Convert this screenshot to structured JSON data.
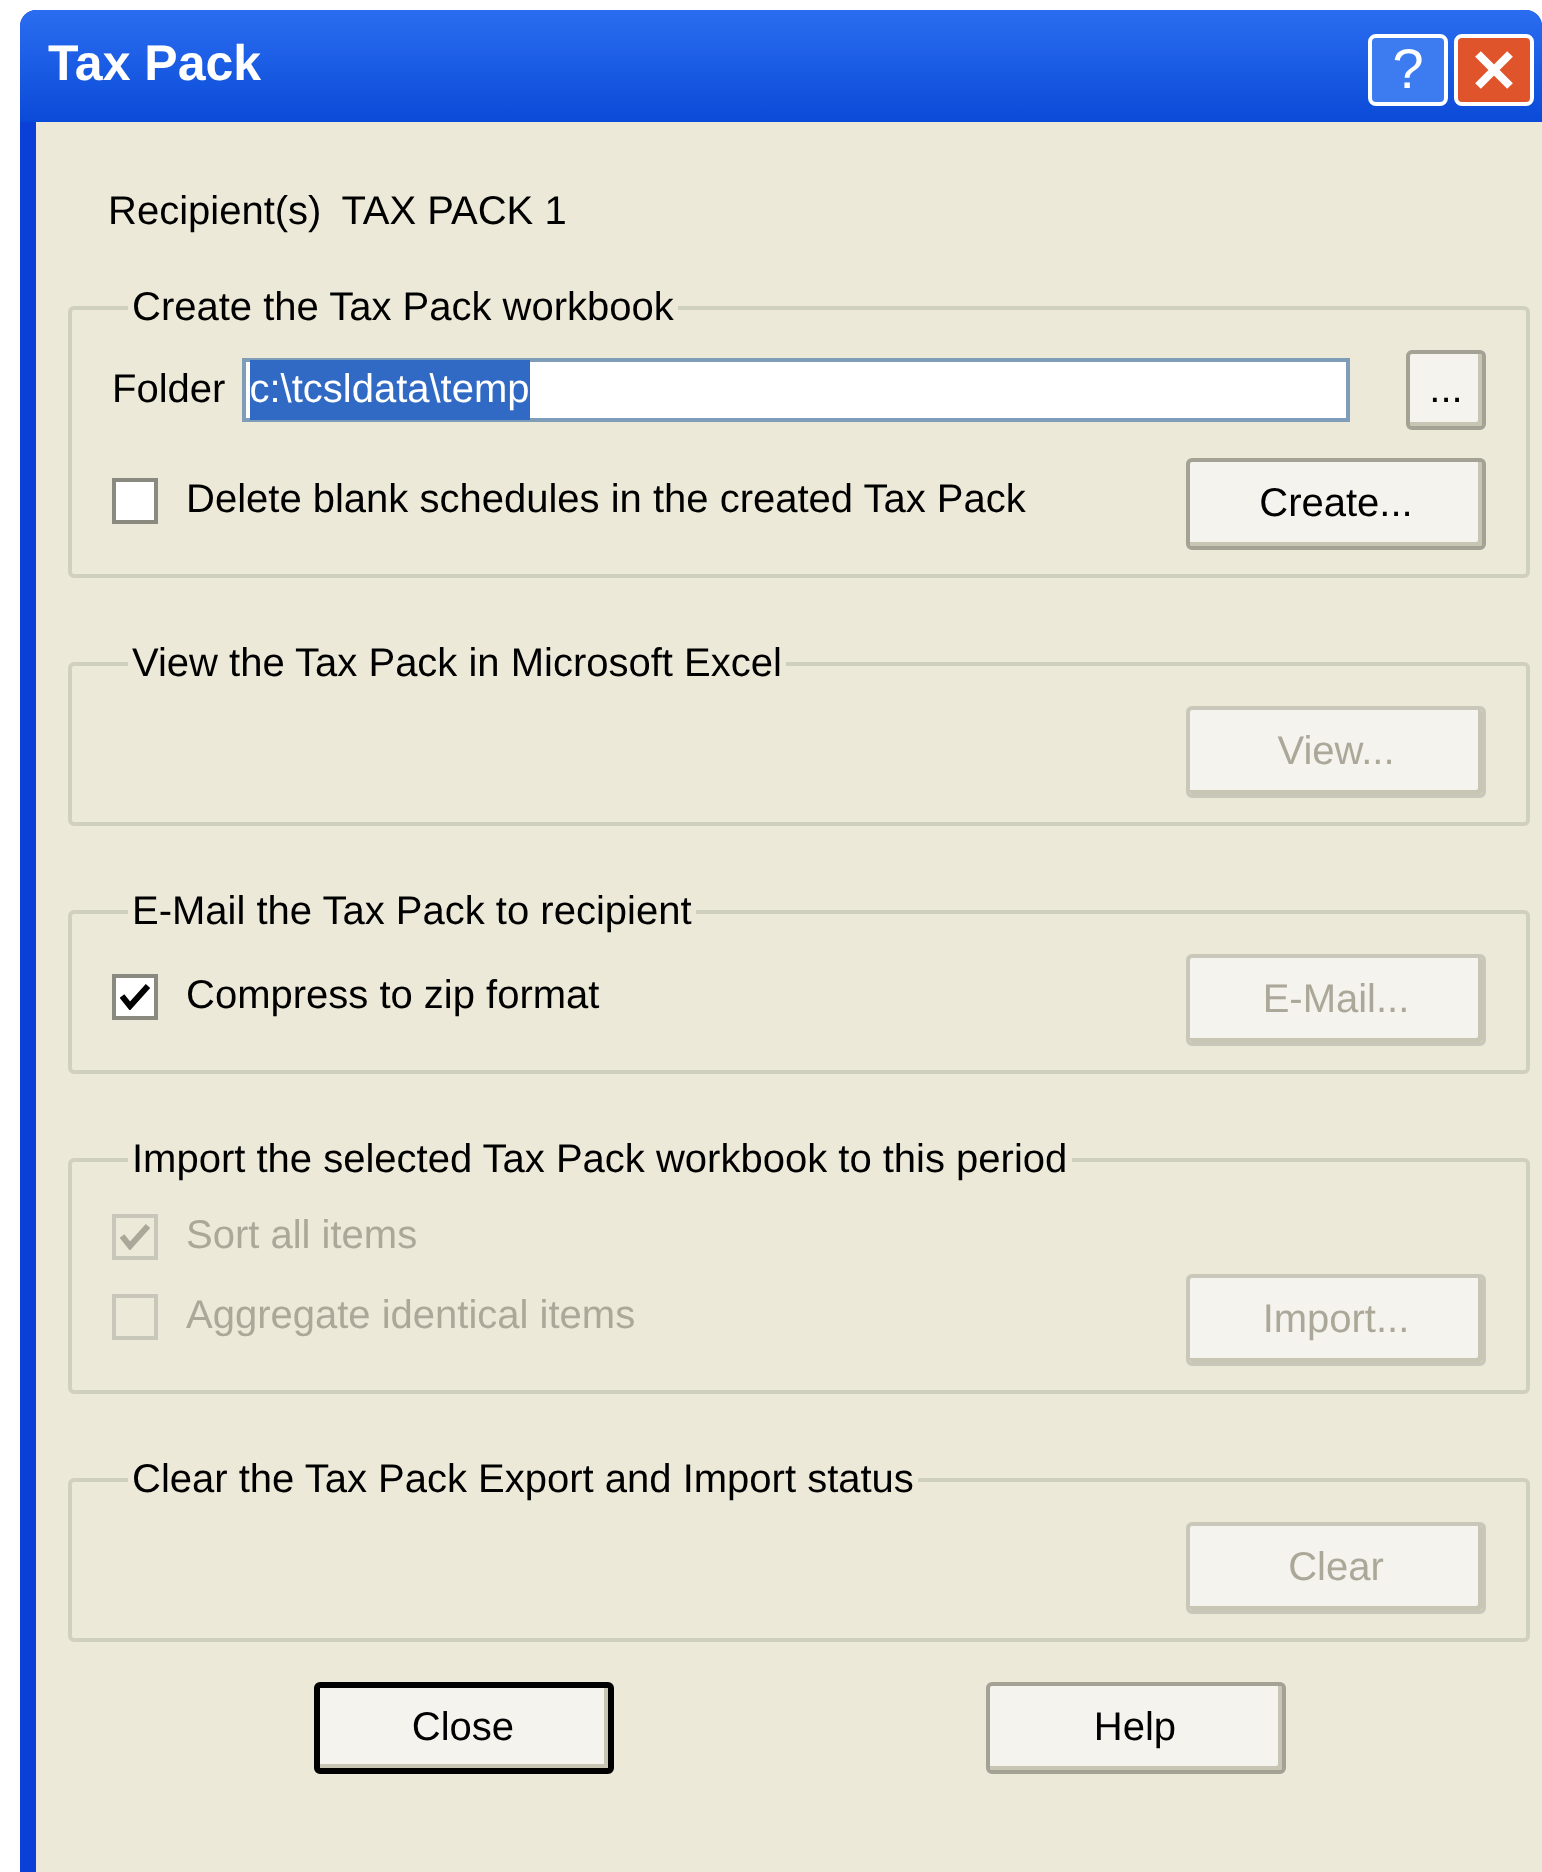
{
  "window": {
    "title": "Tax Pack",
    "title_buttons": [
      {
        "kind": "help",
        "label": "?"
      },
      {
        "kind": "close"
      }
    ]
  },
  "recipient": {
    "label": "Recipient(s)",
    "value": "TAX PACK 1"
  },
  "groups": [
    {
      "title": "Create the Tax Pack workbook",
      "folder": {
        "label": "Folder",
        "value": "c:\\tcsldata\\temp",
        "selected": true,
        "browse": "..."
      },
      "checkboxes": [
        {
          "label": "Delete blank schedules in the created Tax Pack",
          "checked": false,
          "disabled": false
        }
      ],
      "button": {
        "label": "Create...",
        "disabled": false
      }
    },
    {
      "title": "View the Tax Pack in Microsoft Excel",
      "button": {
        "label": "View...",
        "disabled": true
      }
    },
    {
      "title": "E-Mail the Tax Pack to recipient",
      "checkboxes": [
        {
          "label": "Compress to zip format",
          "checked": true,
          "disabled": false
        }
      ],
      "button": {
        "label": "E-Mail...",
        "disabled": true
      }
    },
    {
      "title": "Import the selected Tax Pack workbook to this period",
      "checkboxes": [
        {
          "label": "Sort all items",
          "checked": true,
          "disabled": true
        },
        {
          "label": "Aggregate identical items",
          "checked": false,
          "disabled": true
        }
      ],
      "button": {
        "label": "Import...",
        "disabled": true
      }
    },
    {
      "title": "Clear the Tax Pack Export and Import status",
      "button": {
        "label": "Clear",
        "disabled": true
      }
    }
  ],
  "footer_buttons": [
    {
      "label": "Close",
      "default": true
    },
    {
      "label": "Help",
      "default": false
    }
  ]
}
